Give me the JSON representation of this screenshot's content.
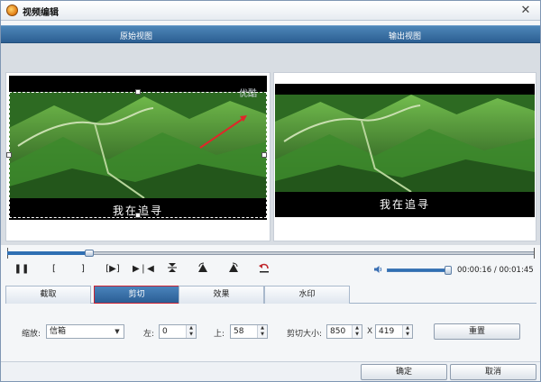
{
  "window": {
    "title": "视频编辑",
    "close": "✕"
  },
  "views": {
    "original": "原始视图",
    "output": "输出视图"
  },
  "preview": {
    "subtitle": "我在追寻",
    "watermark": "优酷"
  },
  "timeline": {
    "progress": 0.155
  },
  "volume": {
    "level": 1.0
  },
  "time": {
    "current": "00:00:16",
    "total": "00:01:45",
    "separator": "/"
  },
  "tabs": [
    "截取",
    "剪切",
    "效果",
    "水印"
  ],
  "active_tab": 1,
  "crop": {
    "zoom_label": "缩放:",
    "zoom_value": "信箱",
    "left_label": "左:",
    "left_value": "0",
    "top_label": "上:",
    "top_value": "58",
    "size_label": "剪切大小:",
    "width_value": "850",
    "x_sep": "X",
    "height_value": "419",
    "reset": "重置"
  },
  "footer": {
    "ok": "确定",
    "cancel": "取消"
  },
  "colors": {
    "accent": "#2f6fb3",
    "header": "#3a6fa6",
    "active_tab_border": "#cc2233"
  },
  "icons": [
    "pause-icon",
    "mark-in-icon",
    "mark-out-icon",
    "play-segment-icon",
    "skip-icon",
    "flip-vertical-icon",
    "rotate-left-icon",
    "rotate-right-icon",
    "undo-icon",
    "volume-icon"
  ]
}
